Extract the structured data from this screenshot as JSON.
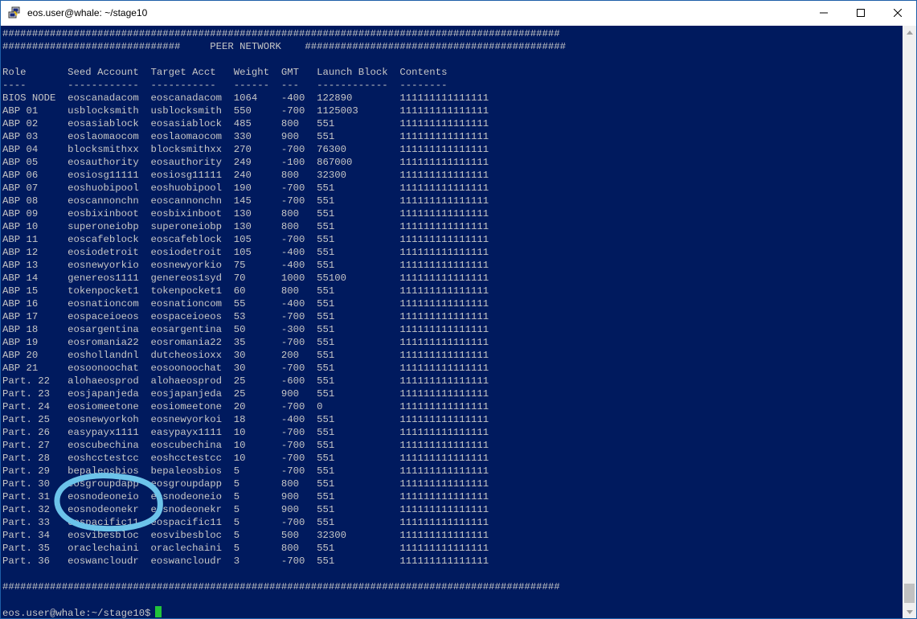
{
  "window": {
    "title": "eos.user@whale: ~/stage10",
    "app_icon": "putty-icon",
    "controls": [
      "minimize-icon",
      "maximize-icon",
      "close-icon"
    ]
  },
  "terminal": {
    "lines": [
      "##############################################################################################",
      "##############################     PEER NETWORK    ############################################",
      "",
      "Role       Seed Account  Target Acct   Weight  GMT   Launch Block  Contents",
      "----       ------------  -----------   ------  ---   ------------  --------",
      "BIOS NODE  eoscanadacom  eoscanadacom  1064    -400  122890        111111111111111",
      "ABP 01     usblocksmith  usblocksmith  550     -700  1125003       111111111111111",
      "ABP 02     eosasiablock  eosasiablock  485     800   551           111111111111111",
      "ABP 03     eoslaomaocom  eoslaomaocom  330     900   551           111111111111111",
      "ABP 04     blocksmithxx  blocksmithxx  270     -700  76300         111111111111111",
      "ABP 05     eosauthority  eosauthority  249     -100  867000        111111111111111",
      "ABP 06     eosiosg11111  eosiosg11111  240     800   32300         111111111111111",
      "ABP 07     eoshuobipool  eoshuobipool  190     -700  551           111111111111111",
      "ABP 08     eoscannonchn  eoscannonchn  145     -700  551           111111111111111",
      "ABP 09     eosbixinboot  eosbixinboot  130     800   551           111111111111111",
      "ABP 10     superoneiobp  superoneiobp  130     800   551           111111111111111",
      "ABP 11     eoscafeblock  eoscafeblock  105     -700  551           111111111111111",
      "ABP 12     eosiodetroit  eosiodetroit  105     -400  551           111111111111111",
      "ABP 13     eosnewyorkio  eosnewyorkio  75      -400  551           111111111111111",
      "ABP 14     genereos1111  genereos1syd  70      1000  55100         111111111111111",
      "ABP 15     tokenpocket1  tokenpocket1  60      800   551           111111111111111",
      "ABP 16     eosnationcom  eosnationcom  55      -400  551           111111111111111",
      "ABP 17     eospaceioeos  eospaceioeos  53      -700  551           111111111111111",
      "ABP 18     eosargentina  eosargentina  50      -300  551           111111111111111",
      "ABP 19     eosromania22  eosromania22  35      -700  551           111111111111111",
      "ABP 20     eoshollandnl  dutcheosioxx  30      200   551           111111111111111",
      "ABP 21     eosoonoochat  eosoonoochat  30      -700  551           111111111111111",
      "Part. 22   alohaeosprod  alohaeosprod  25      -600  551           111111111111111",
      "Part. 23   eosjapanjeda  eosjapanjeda  25      900   551           111111111111111",
      "Part. 24   eosiomeetone  eosiomeetone  20      -700  0             111111111111111",
      "Part. 25   eosnewyorkoh  eosnewyorkoi  18      -400  551           111111111111111",
      "Part. 26   easypayx1111  easypayx1111  10      -700  551           111111111111111",
      "Part. 27   eoscubechina  eoscubechina  10      -700  551           111111111111111",
      "Part. 28   eoshcctestcc  eoshcctestcc  10      -700  551           111111111111111",
      "Part. 29   bepaleosbios  bepaleosbios  5       -700  551           111111111111111",
      "Part. 30   eosgroupdapp  eosgroupdapp  5       800   551           111111111111111",
      "Part. 31   eosnodeoneio  eosnodeoneio  5       900   551           111111111111111",
      "Part. 32   eosnodeonekr  eosnodeonekr  5       900   551           111111111111111",
      "Part. 33   eospacific11  eospacific11  5       -700  551           111111111111111",
      "Part. 34   eosvibesbloc  eosvibesbloc  5       500   32300         111111111111111",
      "Part. 35   oraclechaini  oraclechaini  5       800   551           111111111111111",
      "Part. 36   eoswancloudr  eoswancloudr  3       -700  551           111111111111111",
      "",
      "##############################################################################################",
      ""
    ],
    "prompt": "eos.user@whale:~/stage10$",
    "cursor_color": "#22c33a",
    "background_color": "#001a5e",
    "text_color": "#c7c7c7"
  },
  "annotation": {
    "type": "hand-drawn circle",
    "color": "#6cc3ea"
  }
}
